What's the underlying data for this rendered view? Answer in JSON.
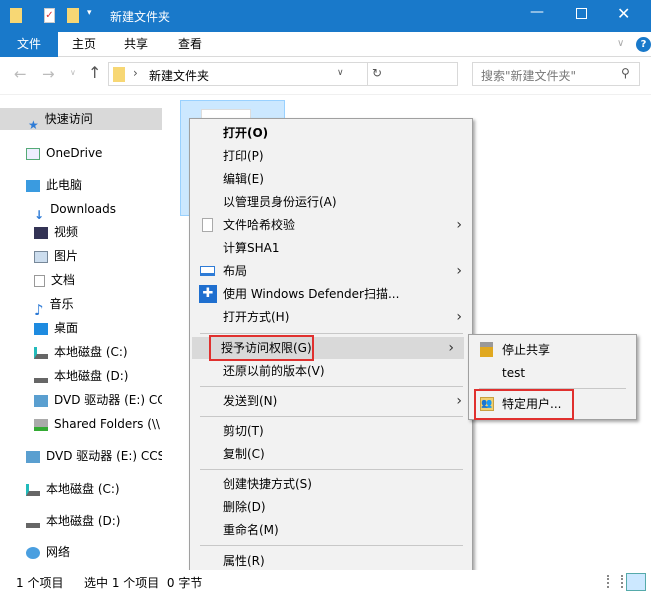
{
  "title": "新建文件夹",
  "ribbon": {
    "tabs": [
      "文件",
      "主页",
      "共享",
      "查看"
    ]
  },
  "address": {
    "path": "新建文件夹",
    "search_placeholder": "搜索\"新建文件夹\""
  },
  "nav": [
    "快速访问",
    "OneDrive",
    "此电脑",
    "Downloads",
    "视频",
    "图片",
    "文档",
    "音乐",
    "桌面",
    "本地磁盘 (C:)",
    "本地磁盘 (D:)",
    "DVD 驱动器 (E:) CC",
    "Shared Folders (\\\\",
    "DVD 驱动器 (E:) CCS",
    "本地磁盘 (C:)",
    "本地磁盘 (D:)",
    "网络"
  ],
  "menu": {
    "open": "打开(O)",
    "print": "打印(P)",
    "edit": "编辑(E)",
    "runas": "以管理员身份运行(A)",
    "hash": "文件哈希校验",
    "sha1": "计算SHA1",
    "layout": "布局",
    "defender": "使用 Windows Defender扫描...",
    "openwith": "打开方式(H)",
    "grant": "授予访问权限(G)",
    "restore": "还原以前的版本(V)",
    "sendto": "发送到(N)",
    "cut": "剪切(T)",
    "copy": "复制(C)",
    "shortcut": "创建快捷方式(S)",
    "delete": "删除(D)",
    "rename": "重命名(M)",
    "props": "属性(R)"
  },
  "submenu": {
    "stop": "停止共享",
    "test": "test",
    "specific": "特定用户..."
  },
  "status": {
    "count": "1 个项目",
    "selected": "选中 1 个项目  0 字节"
  },
  "colors": {
    "accent": "#1979ca",
    "highlight": "#e0302e"
  }
}
